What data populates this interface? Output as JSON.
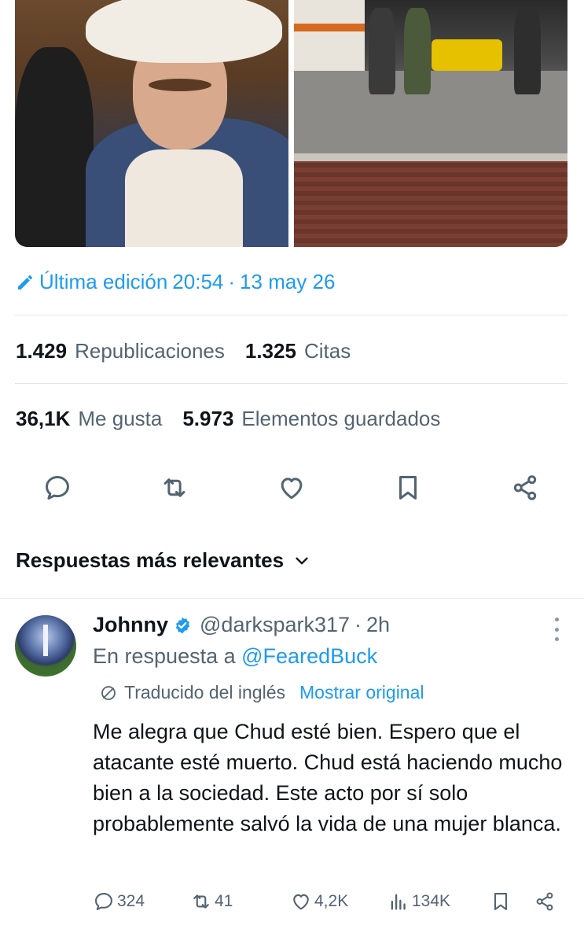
{
  "tweet": {
    "edited": {
      "label": "Última edición",
      "time": "20:54",
      "separator": "·",
      "date": "13 may 26"
    },
    "stats_row1": [
      {
        "value": "1.429",
        "label": "Republicaciones"
      },
      {
        "value": "1.325",
        "label": "Citas"
      }
    ],
    "stats_row2": [
      {
        "value": "36,1K",
        "label": "Me gusta"
      },
      {
        "value": "5.973",
        "label": "Elementos guardados"
      }
    ],
    "actions": [
      "reply-icon",
      "retweet-icon",
      "like-icon",
      "bookmark-icon",
      "share-icon"
    ]
  },
  "replies_header": {
    "label": "Respuestas más relevantes",
    "icon": "chevron-down-icon"
  },
  "reply": {
    "name": "Johnny",
    "handle": "@darkspark317",
    "separator": "·",
    "time": "2h",
    "in_reply_label": "En respuesta a",
    "in_reply_mention": "@FearedBuck",
    "translated_label": "Traducido del inglés",
    "show_original": "Mostrar original",
    "body": "Me alegra que Chud esté bien. Espero que el atacante esté muerto. Chud está haciendo mucho bien a la sociedad. Este acto por sí solo probablemente salvó la vida de una mujer blanca.",
    "counts": {
      "replies": "324",
      "reposts": "41",
      "likes": "4,2K",
      "views": "134K"
    }
  },
  "colors": {
    "accent": "#1d9bf0",
    "text": "#0f1419",
    "muted": "#536471"
  }
}
